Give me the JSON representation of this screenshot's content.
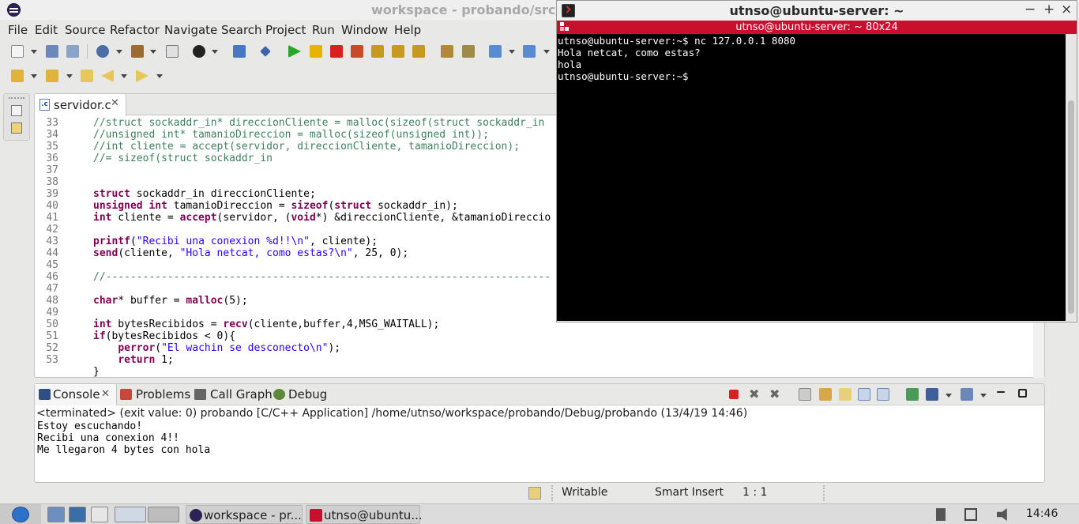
{
  "eclipse": {
    "title": "workspace - probando/src/se",
    "menu": [
      "File",
      "Edit",
      "Source",
      "Refactor",
      "Navigate",
      "Search",
      "Project",
      "Run",
      "Window",
      "Help"
    ],
    "editor_tab": "servidor.c",
    "code_lines": [
      {
        "n": "33",
        "text": "//struct sockaddr_in* direccionCliente = malloc(sizeof(struct sockaddr_in"
      },
      {
        "n": "34",
        "text": "//unsigned int* tamanioDireccion = malloc(sizeof(unsigned int));"
      },
      {
        "n": "35",
        "text": "//int cliente = accept(servidor, direccionCliente, tamanioDireccion);"
      },
      {
        "n": "36",
        "text": "//= sizeof(struct sockaddr_in"
      },
      {
        "n": "37",
        "text": ""
      },
      {
        "n": "38",
        "text": ""
      },
      {
        "n": "39",
        "text": "struct sockaddr_in direccionCliente;"
      },
      {
        "n": "40",
        "text": "unsigned int tamanioDireccion = sizeof(struct sockaddr_in);"
      },
      {
        "n": "41",
        "text": "int cliente = accept(servidor, (void*) &direccionCliente, &tamanioDireccio"
      },
      {
        "n": "42",
        "text": ""
      },
      {
        "n": "43",
        "text": "printf(\"Recibi una conexion %d!!\\n\", cliente);"
      },
      {
        "n": "44",
        "text": "send(cliente, \"Hola netcat, como estas?\\n\", 25, 0);"
      },
      {
        "n": "45",
        "text": ""
      },
      {
        "n": "46",
        "text": "//------------------------------------------------------------------------"
      },
      {
        "n": "47",
        "text": ""
      },
      {
        "n": "48",
        "text": "char* buffer = malloc(5);"
      },
      {
        "n": "49",
        "text": ""
      },
      {
        "n": "50",
        "text": "int bytesRecibidos = recv(cliente,buffer,4,MSG_WAITALL);"
      },
      {
        "n": "51",
        "text": "if(bytesRecibidos < 0){"
      },
      {
        "n": "52",
        "text": "    perror(\"El wachin se desconecto\\n\");"
      },
      {
        "n": "53",
        "text": "    return 1;"
      },
      {
        "n": "",
        "text": "}"
      }
    ],
    "console_tabs": {
      "console": "Console",
      "problems": "Problems",
      "call_graph": "Call Graph",
      "debug": "Debug"
    },
    "console_status": "<terminated> (exit value: 0) probando [C/C++ Application] /home/utnso/workspace/probando/Debug/probando (13/4/19 14:46)",
    "console_output": [
      "Estoy escuchando!",
      "Recibi una conexion 4!!",
      "Me llegaron 4 bytes con hola"
    ],
    "status": {
      "mode": "Writable",
      "insert": "Smart Insert",
      "position": "1 : 1"
    }
  },
  "terminal": {
    "title": "utnso@ubuntu-server: ~",
    "tab": "utnso@ubuntu-server: ~ 80x24",
    "lines": [
      "utnso@ubuntu-server:~$ nc 127.0.0.1 8080",
      "Hola netcat, como estas?",
      "hola",
      "utnso@ubuntu-server:~$"
    ],
    "buttons": {
      "minimize": "−",
      "maximize": "+",
      "close": "×"
    }
  },
  "taskbar": {
    "tasks": [
      "workspace - pr...",
      "utnso@ubuntu..."
    ],
    "clock": "14:46"
  }
}
